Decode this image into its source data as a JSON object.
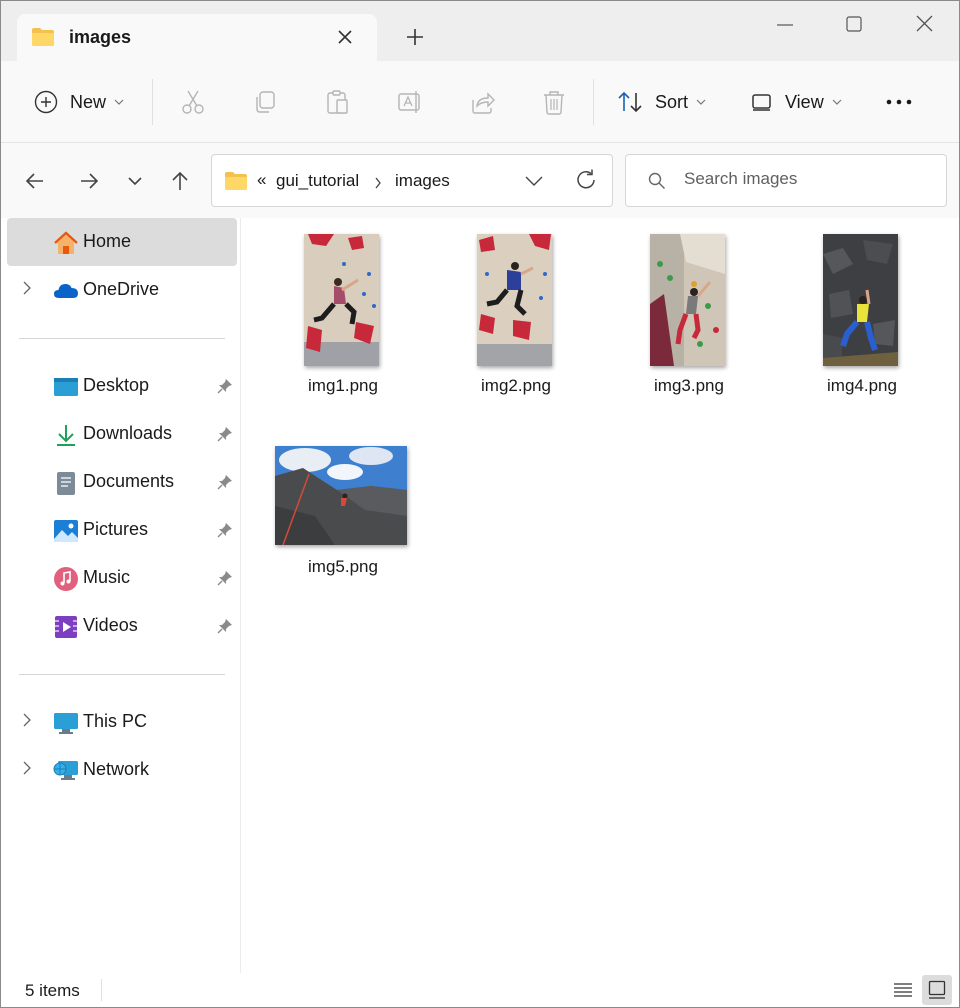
{
  "titlebar": {
    "tab_title": "images",
    "folder_color": "#f2c14e"
  },
  "toolbar": {
    "new_label": "New",
    "sort_label": "Sort",
    "view_label": "View"
  },
  "address": {
    "overflow": "«",
    "crumbs": [
      "gui_tutorial",
      "images"
    ]
  },
  "search": {
    "placeholder": "Search images"
  },
  "sidebar": {
    "items": [
      {
        "label": "Home",
        "icon": "home-icon"
      },
      {
        "label": "OneDrive",
        "icon": "cloud-icon"
      },
      {
        "label": "Desktop",
        "icon": "desktop-icon"
      },
      {
        "label": "Downloads",
        "icon": "download-icon"
      },
      {
        "label": "Documents",
        "icon": "document-icon"
      },
      {
        "label": "Pictures",
        "icon": "pictures-icon"
      },
      {
        "label": "Music",
        "icon": "music-icon"
      },
      {
        "label": "Videos",
        "icon": "video-icon"
      },
      {
        "label": "This PC",
        "icon": "computer-icon"
      },
      {
        "label": "Network",
        "icon": "network-icon"
      }
    ]
  },
  "files": [
    {
      "name": "img1.png"
    },
    {
      "name": "img2.png"
    },
    {
      "name": "img3.png"
    },
    {
      "name": "img4.png"
    },
    {
      "name": "img5.png"
    }
  ],
  "status": {
    "count": "5 items"
  },
  "colors": {
    "accent": "#0067c0",
    "selected_bg": "#dcdcdc",
    "toolbar_bg": "#f9f9f9"
  }
}
